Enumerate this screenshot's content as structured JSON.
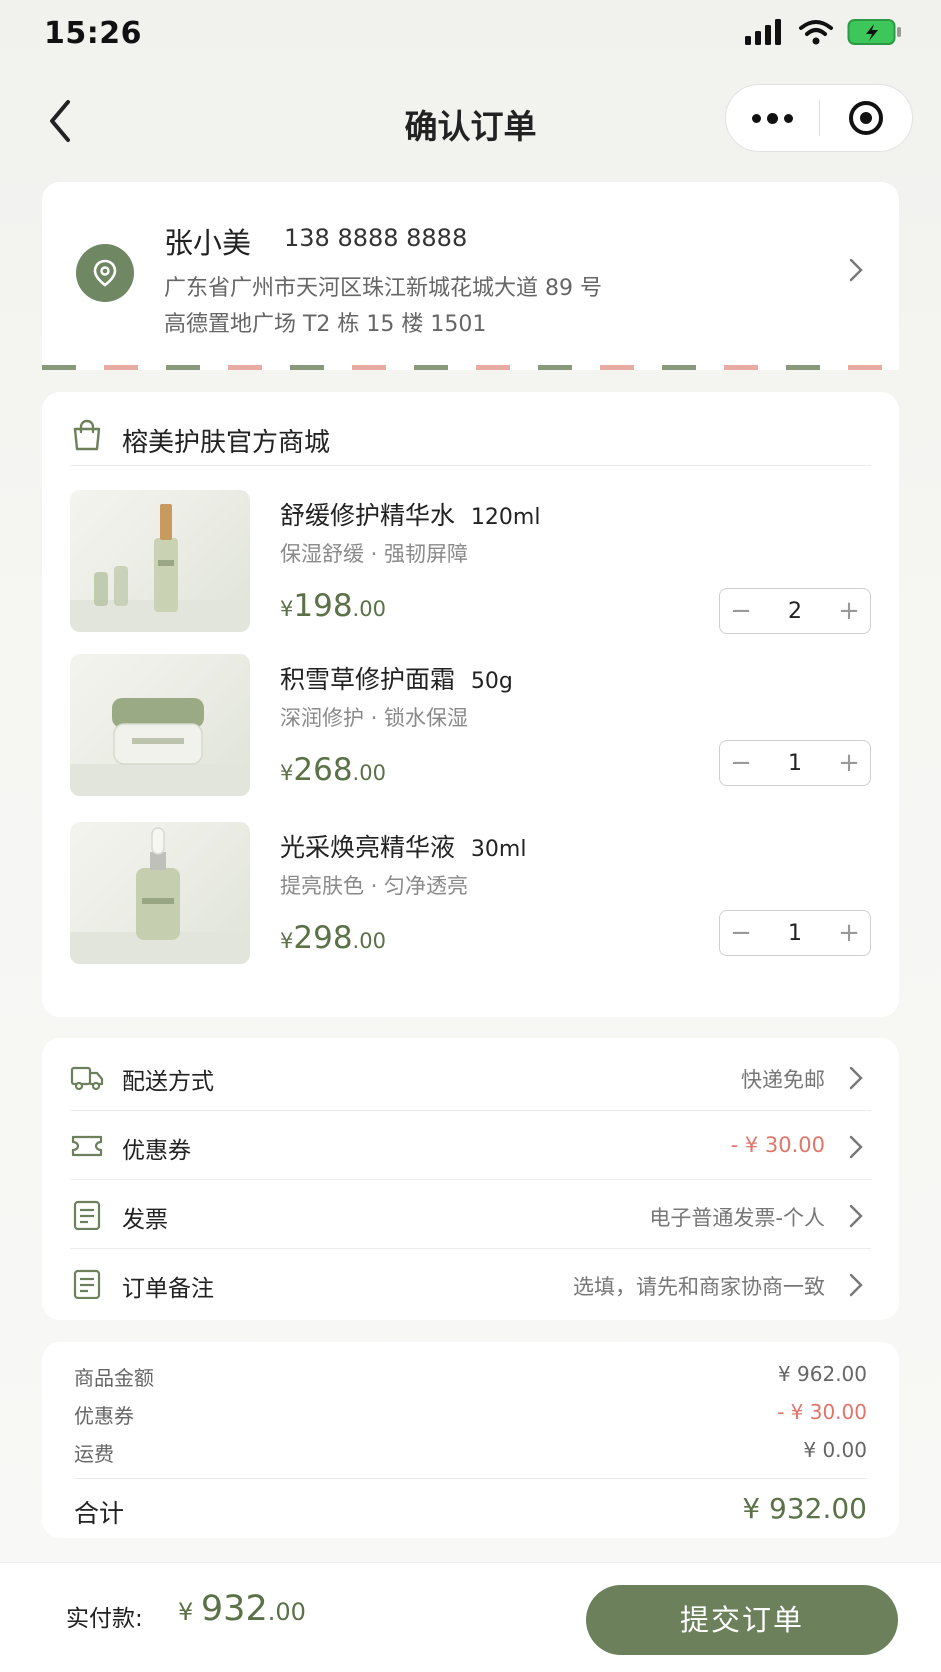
{
  "status_bar": {
    "time": "15:26"
  },
  "nav": {
    "title": "确认订单"
  },
  "address": {
    "name": "张小美",
    "phone": "138 8888 8888",
    "line1": "广东省广州市天河区珠江新城花城大道 89 号",
    "line2": "高德置地广场 T2 栋 15 楼 1501"
  },
  "shop": {
    "name": "榕美护肤官方商城"
  },
  "items": [
    {
      "title": "舒缓修护精华水",
      "spec": "120ml",
      "subtitle": "保湿舒缓 · 强韧屏障",
      "price_yen": "¥",
      "price_int": "198",
      "price_dec": ".00",
      "qty": "2"
    },
    {
      "title": "积雪草修护面霜",
      "spec": "50g",
      "subtitle": "深润修护 · 锁水保湿",
      "price_yen": "¥",
      "price_int": "268",
      "price_dec": ".00",
      "qty": "1"
    },
    {
      "title": "光采焕亮精华液",
      "spec": "30ml",
      "subtitle": "提亮肤色 · 匀净透亮",
      "price_yen": "¥",
      "price_int": "298",
      "price_dec": ".00",
      "qty": "1"
    }
  ],
  "options": [
    {
      "label": "配送方式",
      "value": "快递免邮",
      "icon": "truck-icon"
    },
    {
      "label": "优惠券",
      "value": "- ¥ 30.00",
      "icon": "ticket-icon"
    },
    {
      "label": "发票",
      "value": "电子普通发票-个人",
      "icon": "document-icon"
    },
    {
      "label": "订单备注",
      "value": "选填，请先和商家协商一致",
      "icon": "note-icon"
    }
  ],
  "summary": {
    "goods_label": "商品金额",
    "goods_value": "¥ 962.00",
    "coupon_label": "优惠券",
    "coupon_value": "- ¥ 30.00",
    "shipping_label": "运费",
    "shipping_value": "¥ 0.00",
    "total_label": "合计",
    "total_value": "¥ 932.00"
  },
  "bottom": {
    "pay_label": "实付款:",
    "pay_yen": "¥ ",
    "pay_int": "932",
    "pay_dec": ".00",
    "submit_label": "提交订单"
  },
  "colors": {
    "accent": "#6c805c",
    "price": "#5b7148",
    "discount": "#e0756a"
  }
}
